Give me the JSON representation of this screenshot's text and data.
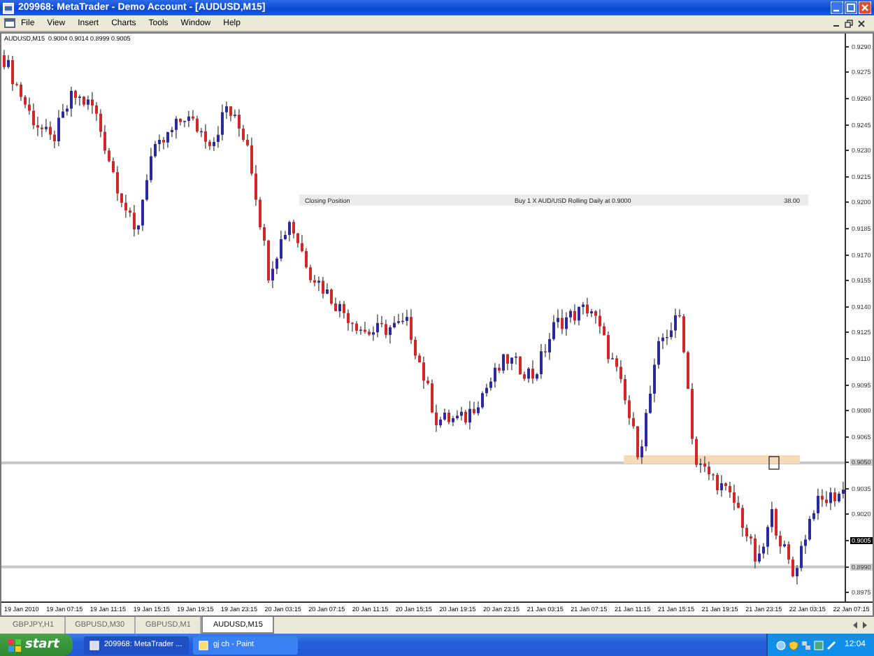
{
  "window": {
    "title": "209968: MetaTrader - Demo Account - [AUDUSD,M15]"
  },
  "menu": [
    "File",
    "View",
    "Insert",
    "Charts",
    "Tools",
    "Window",
    "Help"
  ],
  "chart": {
    "header": "AUDUSD,M15  0.9004 0.9014 0.8999 0.9005",
    "price_labels": [
      {
        "text": "0.9290",
        "kind": "plain"
      },
      {
        "text": "0.9275",
        "kind": "plain"
      },
      {
        "text": "0.9260",
        "kind": "plain"
      },
      {
        "text": "0.9245",
        "kind": "plain"
      },
      {
        "text": "0.9230",
        "kind": "plain"
      },
      {
        "text": "0.9215",
        "kind": "plain"
      },
      {
        "text": "0.9200",
        "kind": "plain"
      },
      {
        "text": "0.9185",
        "kind": "plain"
      },
      {
        "text": "0.9170",
        "kind": "plain"
      },
      {
        "text": "0.9155",
        "kind": "plain"
      },
      {
        "text": "0.9140",
        "kind": "plain"
      },
      {
        "text": "0.9125",
        "kind": "plain"
      },
      {
        "text": "0.9110",
        "kind": "plain"
      },
      {
        "text": "0.9095",
        "kind": "plain"
      },
      {
        "text": "0.9080",
        "kind": "plain"
      },
      {
        "text": "0.9065",
        "kind": "plain"
      },
      {
        "text": "0.9050",
        "kind": "line"
      },
      {
        "text": "0.9035",
        "kind": "plain"
      },
      {
        "text": "0.9020",
        "kind": "plain"
      },
      {
        "text": "0.9005",
        "kind": "current"
      },
      {
        "text": "0.8990",
        "kind": "line"
      },
      {
        "text": "0.8975",
        "kind": "plain"
      }
    ],
    "time_labels": [
      "19 Jan 2010",
      "19 Jan 07:15",
      "19 Jan 11:15",
      "19 Jan 15:15",
      "19 Jan 19:15",
      "19 Jan 23:15",
      "20 Jan 03:15",
      "20 Jan 07:15",
      "20 Jan 11:15",
      "20 Jan 15:15",
      "20 Jan 19:15",
      "20 Jan 23:15",
      "21 Jan 03:15",
      "21 Jan 07:15",
      "21 Jan 11:15",
      "21 Jan 15:15",
      "21 Jan 19:15",
      "21 Jan 23:15",
      "22 Jan 03:15",
      "22 Jan 07:15"
    ],
    "trade_row": {
      "label": "Closing Position",
      "description": "Buy 1 X AUD/USD Rolling Daily at 0.9000",
      "amount": "38.00"
    }
  },
  "tabs": [
    {
      "label": "GBPJPY,H1",
      "selected": false
    },
    {
      "label": "GBPUSD,M30",
      "selected": false
    },
    {
      "label": "GBPUSD,M1",
      "selected": false
    },
    {
      "label": "AUDUSD,M15",
      "selected": true
    }
  ],
  "taskbar": {
    "start": "start",
    "tasks": [
      {
        "label": "209968: MetaTrader ...",
        "selected": true
      },
      {
        "label": "gj ch - Paint",
        "selected": false
      }
    ],
    "clock": "12:04"
  }
}
